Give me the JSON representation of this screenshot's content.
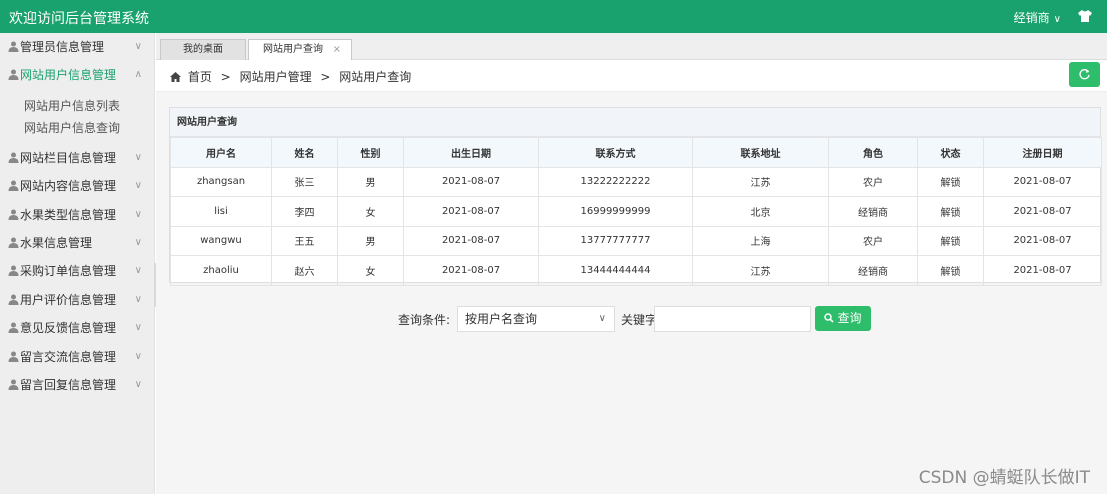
{
  "header": {
    "title": "欢迎访问后台管理系统",
    "user": "经销商",
    "brand_color": "#1aa26e"
  },
  "sidebar": {
    "items": [
      {
        "label": "管理员信息管理",
        "expanded": false
      },
      {
        "label": "网站用户信息管理",
        "expanded": true,
        "active": true,
        "children": [
          {
            "label": "网站用户信息列表"
          },
          {
            "label": "网站用户信息查询"
          }
        ]
      },
      {
        "label": "网站栏目信息管理",
        "expanded": false
      },
      {
        "label": "网站内容信息管理",
        "expanded": false
      },
      {
        "label": "水果类型信息管理",
        "expanded": false
      },
      {
        "label": "水果信息管理",
        "expanded": false
      },
      {
        "label": "采购订单信息管理",
        "expanded": false
      },
      {
        "label": "用户评价信息管理",
        "expanded": false
      },
      {
        "label": "意见反馈信息管理",
        "expanded": false
      },
      {
        "label": "留言交流信息管理",
        "expanded": false
      },
      {
        "label": "留言回复信息管理",
        "expanded": false
      }
    ]
  },
  "tabs": [
    {
      "label": "我的桌面"
    },
    {
      "label": "网站用户查询",
      "close": "×",
      "active": true
    }
  ],
  "breadcrumb": {
    "items": [
      "首页",
      "网站用户管理",
      "网站用户查询"
    ],
    "separator": ">"
  },
  "panel": {
    "title": "网站用户查询"
  },
  "table": {
    "headers": [
      "用户名",
      "姓名",
      "性别",
      "出生日期",
      "联系方式",
      "联系地址",
      "角色",
      "状态",
      "注册日期"
    ],
    "rows": [
      [
        "zhangsan",
        "张三",
        "男",
        "2021-08-07",
        "13222222222",
        "江苏",
        "农户",
        "解锁",
        "2021-08-07"
      ],
      [
        "lisi",
        "李四",
        "女",
        "2021-08-07",
        "16999999999",
        "北京",
        "经销商",
        "解锁",
        "2021-08-07"
      ],
      [
        "wangwu",
        "王五",
        "男",
        "2021-08-07",
        "13777777777",
        "上海",
        "农户",
        "解锁",
        "2021-08-07"
      ],
      [
        "zhaoliu",
        "赵六",
        "女",
        "2021-08-07",
        "13444444444",
        "江苏",
        "经销商",
        "解锁",
        "2021-08-07"
      ]
    ]
  },
  "search": {
    "condition_label": "查询条件:",
    "condition_value": "按用户名查询",
    "keyword_label": "关键字",
    "keyword_value": "",
    "button_label": "查询"
  },
  "watermark": "CSDN @蜻蜓队长做IT",
  "icons": {
    "menu_item": "person-icon",
    "refresh": "refresh-icon",
    "search": "search-icon",
    "home": "home-icon",
    "skin": "shirt-icon"
  }
}
